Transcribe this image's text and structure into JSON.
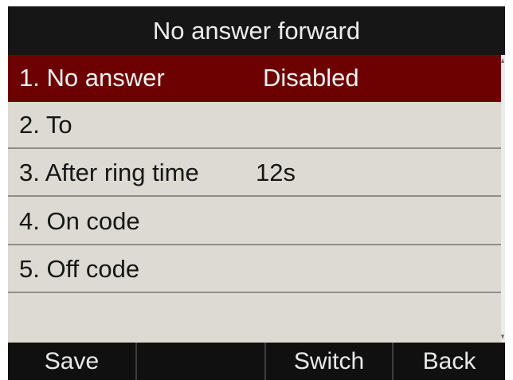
{
  "title": "No answer forward",
  "menu": {
    "items": [
      {
        "label": "1. No answer",
        "value": "Disabled"
      },
      {
        "label": "2. To",
        "value": ""
      },
      {
        "label": "3. After ring time",
        "value": "12s"
      },
      {
        "label": "4. On code",
        "value": ""
      },
      {
        "label": "5. Off code",
        "value": ""
      }
    ]
  },
  "softkeys": [
    "Save",
    "",
    "Switch",
    "Back"
  ],
  "colors": {
    "selected_row": "#6d0000",
    "list_background": "#dcdad2",
    "title_background": "#161616",
    "softkey_background": "#101010"
  }
}
